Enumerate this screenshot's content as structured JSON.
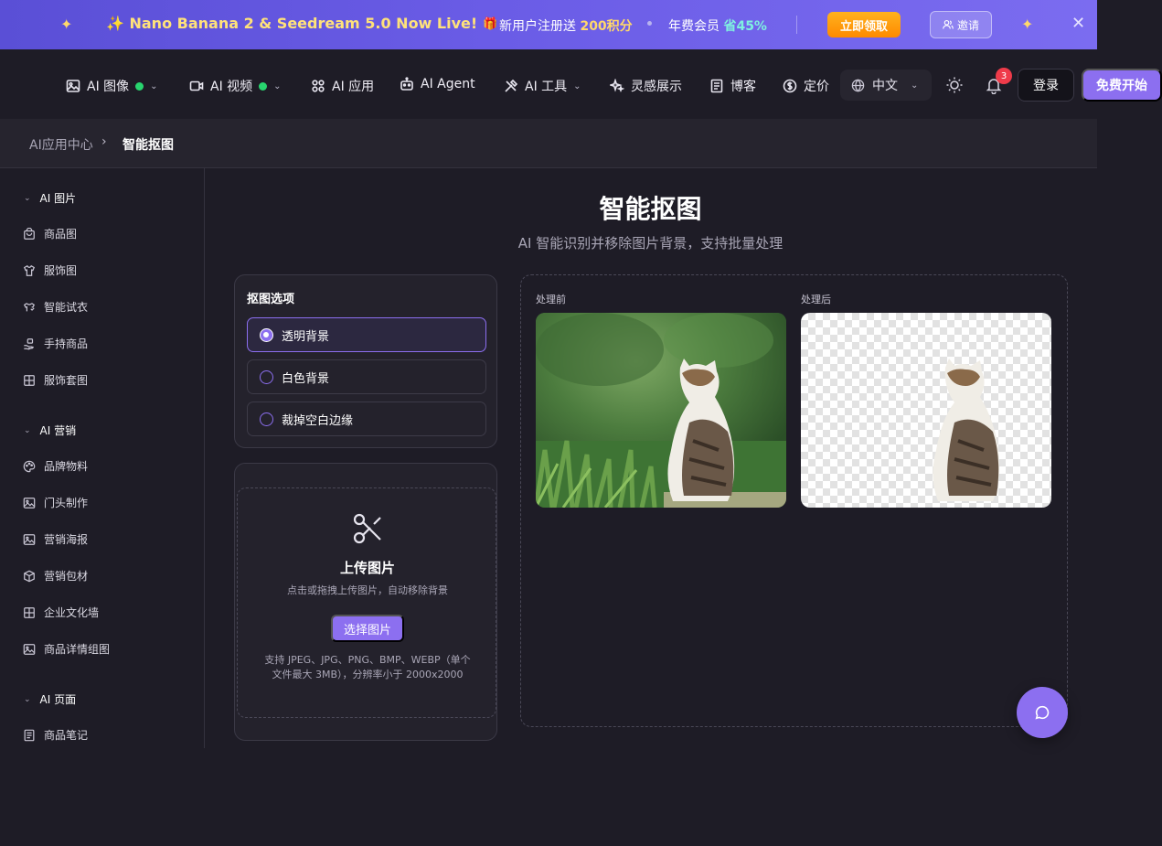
{
  "promo": {
    "title": "✨ Nano Banana 2 & Seedream 5.0 Now Live!",
    "gift_text_prefix": "新用户注册送",
    "gift_text_value": "200积分",
    "member_text_prefix": "年费会员",
    "member_text_value": "省45%",
    "claim_label": "立即领取",
    "invite_label": "邀请"
  },
  "nav": {
    "items": [
      {
        "label": "AI 图像",
        "icon": "image-icon",
        "dot": true,
        "chevron": true
      },
      {
        "label": "AI 视频",
        "icon": "video-icon",
        "dot": true,
        "chevron": true
      },
      {
        "label": "AI 应用",
        "icon": "apps-icon",
        "dot": false,
        "chevron": false
      },
      {
        "label": "AI Agent",
        "icon": "robot-icon",
        "dot": false,
        "chevron": false
      },
      {
        "label": "AI 工具",
        "icon": "tools-icon",
        "dot": false,
        "chevron": true
      },
      {
        "label": "灵感展示",
        "icon": "sparkles-icon",
        "dot": false,
        "chevron": false
      },
      {
        "label": "博客",
        "icon": "document-icon",
        "dot": false,
        "chevron": false
      },
      {
        "label": "定价",
        "icon": "dollar-icon",
        "dot": false,
        "chevron": false
      }
    ],
    "language": "中文",
    "notification_count": "3",
    "login_label": "登录",
    "start_label": "免费开始"
  },
  "breadcrumb": {
    "parent": "AI应用中心",
    "current": "智能抠图"
  },
  "sidebar": {
    "groups": [
      {
        "label": "AI 图片",
        "items": [
          "商品图",
          "服饰图",
          "智能试衣",
          "手持商品",
          "服饰套图"
        ]
      },
      {
        "label": "AI 营销",
        "items": [
          "品牌物料",
          "门头制作",
          "营销海报",
          "营销包材",
          "企业文化墙",
          "商品详情组图"
        ]
      },
      {
        "label": "AI 页面",
        "items": [
          "商品笔记"
        ]
      }
    ]
  },
  "main": {
    "title": "智能抠图",
    "subtitle": "AI 智能识别并移除图片背景，支持批量处理",
    "options_title": "抠图选项",
    "options": [
      {
        "label": "透明背景",
        "selected": true
      },
      {
        "label": "白色背景",
        "selected": false
      },
      {
        "label": "裁掉空白边缘",
        "selected": false
      }
    ],
    "upload": {
      "title": "上传图片",
      "subtitle": "点击或拖拽上传图片，自动移除背景",
      "button": "选择图片",
      "note": "支持 JPEG、JPG、PNG、BMP、WEBP（单个文件最大 3MB），分辨率小于 2000x2000"
    },
    "preview": {
      "before_label": "处理前",
      "after_label": "处理后"
    }
  },
  "colors": {
    "accent": "#8c6ff0",
    "background": "#1e1c26",
    "online_dot": "#28d46e",
    "badge": "#ef3b4a"
  }
}
